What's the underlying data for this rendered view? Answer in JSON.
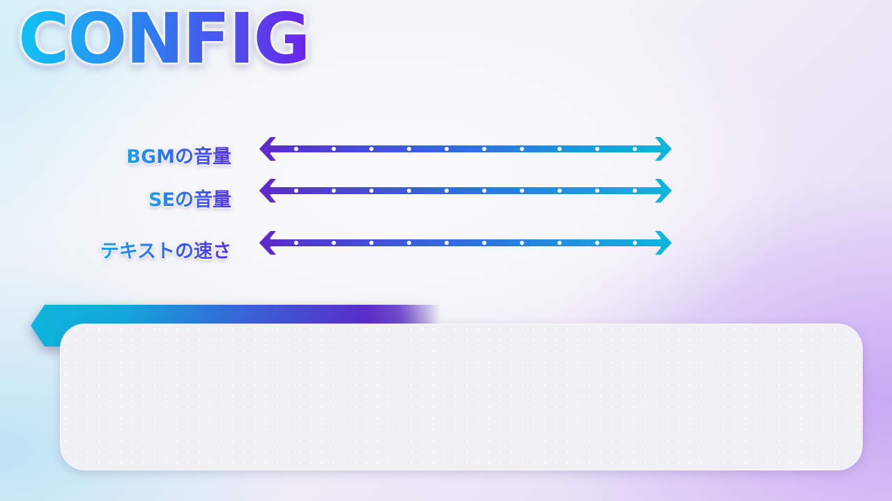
{
  "screen": {
    "title": "CONFIG"
  },
  "settings": [
    {
      "label": "BGMの音量",
      "notches": 10
    },
    {
      "label": "SEの音量",
      "notches": 10
    },
    {
      "label": "テキストの速さ",
      "notches": 10
    }
  ],
  "colors": {
    "accent_cyan": "#0fb4dc",
    "accent_blue": "#2f6fe0",
    "accent_purple": "#5c2ccc"
  }
}
